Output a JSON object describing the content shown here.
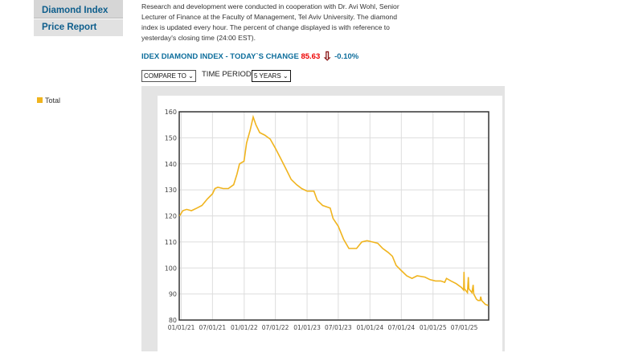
{
  "sidebar": {
    "items": [
      {
        "label": "Diamond Index"
      },
      {
        "label": "Price Report"
      }
    ]
  },
  "description": "Research and development were conducted in cooperation with Dr. Avi Wohl, Senior Lecturer of Finance at the Faculty of Management, Tel Aviv University. The diamond index is updated every hour. The percent of change displayed is with reference to yesterday's closing time (24:00 EST).",
  "index": {
    "title": "IDEX DIAMOND INDEX - TODAY`S CHANGE",
    "value": "85.63",
    "change": "-0.10%",
    "direction": "down",
    "arrow_color": "#8b1a1a"
  },
  "controls": {
    "compare_label": "COMPARE TO",
    "time_period_label": "TIME PERIOD",
    "time_period_value": "5 YEARS"
  },
  "chart_data": {
    "type": "line",
    "legend": [
      {
        "name": "Total",
        "color": "#f0b41e"
      }
    ],
    "legend_position": "left",
    "grid": true,
    "ylim": [
      80,
      160
    ],
    "yticks": [
      80,
      90,
      100,
      110,
      120,
      130,
      140,
      150,
      160
    ],
    "xlim": [
      "2020-12-20",
      "2025-11-20"
    ],
    "xticks": [
      "01/01/21",
      "07/01/21",
      "01/01/22",
      "07/01/22",
      "01/01/23",
      "07/01/23",
      "01/01/24",
      "07/01/24",
      "01/01/25",
      "07/01/25"
    ],
    "series": [
      {
        "name": "Total",
        "color": "#f0b41e",
        "points": [
          [
            "2020-12-22",
            120
          ],
          [
            "2021-01-10",
            122
          ],
          [
            "2021-02-01",
            122.5
          ],
          [
            "2021-03-01",
            122
          ],
          [
            "2021-04-01",
            123
          ],
          [
            "2021-05-01",
            124
          ],
          [
            "2021-06-01",
            126.5
          ],
          [
            "2021-07-01",
            128.5
          ],
          [
            "2021-07-15",
            130.5
          ],
          [
            "2021-08-01",
            131
          ],
          [
            "2021-09-01",
            130.5
          ],
          [
            "2021-10-01",
            130.5
          ],
          [
            "2021-11-01",
            132
          ],
          [
            "2021-11-20",
            136
          ],
          [
            "2021-12-05",
            140
          ],
          [
            "2021-12-31",
            141
          ],
          [
            "2022-01-15",
            148
          ],
          [
            "2022-02-05",
            153
          ],
          [
            "2022-02-22",
            158
          ],
          [
            "2022-03-10",
            155
          ],
          [
            "2022-04-01",
            152
          ],
          [
            "2022-05-01",
            151
          ],
          [
            "2022-06-01",
            149.5
          ],
          [
            "2022-07-01",
            146
          ],
          [
            "2022-08-01",
            142
          ],
          [
            "2022-09-01",
            138
          ],
          [
            "2022-10-01",
            134
          ],
          [
            "2022-11-01",
            132
          ],
          [
            "2022-12-01",
            130.5
          ],
          [
            "2023-01-01",
            129.5
          ],
          [
            "2023-02-10",
            129.5
          ],
          [
            "2023-03-01",
            126
          ],
          [
            "2023-04-01",
            124
          ],
          [
            "2023-05-15",
            123
          ],
          [
            "2023-06-01",
            119
          ],
          [
            "2023-07-01",
            116
          ],
          [
            "2023-08-01",
            111
          ],
          [
            "2023-09-01",
            107.5
          ],
          [
            "2023-10-15",
            107.5
          ],
          [
            "2023-11-15",
            110
          ],
          [
            "2023-12-15",
            110.5
          ],
          [
            "2024-01-15",
            110
          ],
          [
            "2024-02-15",
            109.5
          ],
          [
            "2024-03-15",
            107.5
          ],
          [
            "2024-04-15",
            106
          ],
          [
            "2024-05-10",
            104.5
          ],
          [
            "2024-06-01",
            101
          ],
          [
            "2024-07-01",
            99
          ],
          [
            "2024-08-01",
            97
          ],
          [
            "2024-09-01",
            96
          ],
          [
            "2024-10-01",
            97
          ],
          [
            "2024-11-15",
            96.5
          ],
          [
            "2024-12-15",
            95.5
          ],
          [
            "2025-01-15",
            95
          ],
          [
            "2025-02-15",
            95
          ],
          [
            "2025-03-10",
            94.5
          ],
          [
            "2025-03-20",
            96
          ],
          [
            "2025-04-15",
            95
          ],
          [
            "2025-05-15",
            94
          ],
          [
            "2025-06-15",
            92.5
          ],
          [
            "2025-06-28",
            91.5
          ],
          [
            "2025-06-30",
            98.5
          ],
          [
            "2025-07-02",
            92
          ],
          [
            "2025-07-20",
            90.5
          ],
          [
            "2025-07-25",
            96.5
          ],
          [
            "2025-07-28",
            92
          ],
          [
            "2025-08-15",
            90.5
          ],
          [
            "2025-08-22",
            93.5
          ],
          [
            "2025-08-25",
            90
          ],
          [
            "2025-09-10",
            88
          ],
          [
            "2025-09-20",
            87.5
          ],
          [
            "2025-10-01",
            87.5
          ],
          [
            "2025-10-05",
            89
          ],
          [
            "2025-10-10",
            87.5
          ],
          [
            "2025-11-01",
            86
          ],
          [
            "2025-11-18",
            85.6
          ]
        ]
      }
    ]
  }
}
